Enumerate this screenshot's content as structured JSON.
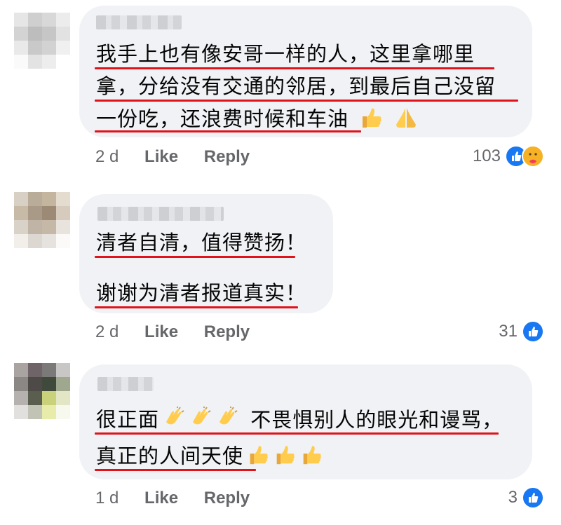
{
  "comments": [
    {
      "lines": [
        "我手上也有像安哥一样的人，这里拿哪里",
        "拿，分给没有交通的邻居，到最后自己没留",
        "一份吃，还浪费时候和车油"
      ],
      "emojis": [
        "thumbs-up-emoji",
        "folded-hands-emoji"
      ],
      "time": "2 d",
      "like_label": "Like",
      "reply_label": "Reply",
      "reaction_count": "103",
      "reactions": [
        "like",
        "care"
      ]
    },
    {
      "lines": [
        "清者自清，值得赞扬！",
        "谢谢为清者报道真实！"
      ],
      "emojis": [],
      "time": "2 d",
      "like_label": "Like",
      "reply_label": "Reply",
      "reaction_count": "31",
      "reactions": [
        "like"
      ]
    },
    {
      "lines": [
        "很正面",
        "不畏惧别人的眼光和谩骂，",
        "真正的人间天使"
      ],
      "emojis": [
        "clapping-hands-emoji",
        "thumbs-up-emoji"
      ],
      "time": "1 d",
      "like_label": "Like",
      "reply_label": "Reply",
      "reaction_count": "3",
      "reactions": [
        "like"
      ]
    }
  ],
  "colors": {
    "bubble": "#f0f2f5",
    "underline": "#e0131a",
    "like_blue": "#1877f2",
    "meta_gray": "#65676b"
  }
}
